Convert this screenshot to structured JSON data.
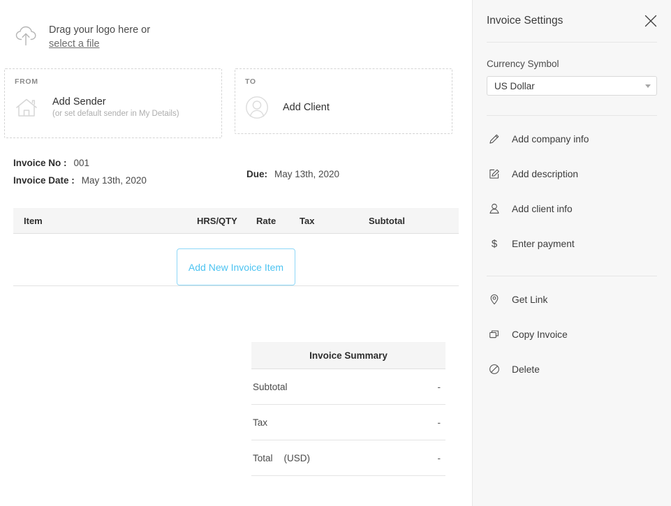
{
  "invoice": {
    "logo_upload": {
      "prompt": "Drag your logo here or",
      "link": "select a file",
      "icon": "cloud-upload-icon"
    },
    "from": {
      "label": "FROM",
      "title": "Add Sender",
      "subtitle": "(or set default sender in My Details)",
      "icon": "house-icon"
    },
    "to": {
      "label": "TO",
      "title": "Add Client",
      "icon": "person-avatar-icon"
    },
    "meta": {
      "invoice_no_label": "Invoice No :",
      "invoice_no_value": "001",
      "invoice_date_label": "Invoice Date :",
      "invoice_date_value": "May 13th, 2020",
      "due_label": "Due:",
      "due_value": "May 13th, 2020"
    },
    "table": {
      "columns": [
        "Item",
        "HRS/QTY",
        "Rate",
        "Tax",
        "Subtotal"
      ],
      "rows": [],
      "add_item_label": "Add New Invoice Item"
    },
    "summary": {
      "title": "Invoice Summary",
      "rows": [
        {
          "label": "Subtotal",
          "currency": "",
          "amount": "-"
        },
        {
          "label": "Tax",
          "currency": "",
          "amount": "-"
        },
        {
          "label": "Total",
          "currency": "(USD)",
          "amount": "-"
        }
      ]
    }
  },
  "settings": {
    "title": "Invoice Settings",
    "close_icon": "close-icon",
    "currency": {
      "label": "Currency Symbol",
      "selected": "US Dollar",
      "caret_icon": "chevron-down-icon"
    },
    "menu_primary": [
      {
        "label": "Add company info",
        "icon": "pencil-icon"
      },
      {
        "label": "Add description",
        "icon": "edit-square-icon"
      },
      {
        "label": "Add client info",
        "icon": "person-icon"
      },
      {
        "label": "Enter payment",
        "icon": "dollar-icon"
      }
    ],
    "menu_secondary": [
      {
        "label": "Get Link",
        "icon": "map-pin-icon"
      },
      {
        "label": "Copy Invoice",
        "icon": "copy-icon"
      },
      {
        "label": "Delete",
        "icon": "ban-icon"
      }
    ]
  },
  "colors": {
    "accent_blue": "#4cc3f1",
    "panel_bg": "#f7f7f7",
    "header_row_bg": "#f5f5f5",
    "text_primary": "#3c3c3c",
    "text_muted": "#adadad"
  }
}
